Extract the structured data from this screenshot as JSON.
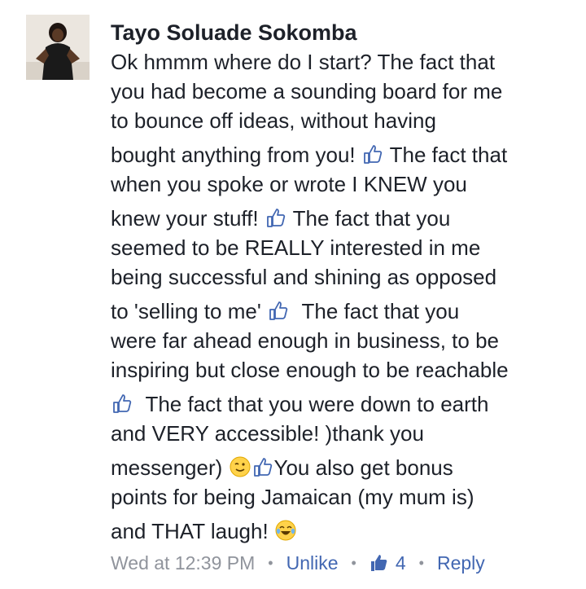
{
  "comment": {
    "author": "Tayo Soluade Sokomba",
    "lines": [
      "Ok hmmm where do I start? The fact that",
      "you had become a sounding board for me",
      "to bounce off ideas, without having",
      "bought anything from you!",
      "The fact that",
      "when you spoke or wrote I KNEW you",
      "knew your stuff!",
      "The fact that you",
      "seemed to be REALLY interested in me",
      "being successful and shining as opposed",
      "to 'selling to me'",
      "The fact that you",
      "were far ahead enough in business, to be",
      "inspiring but close enough to be reachable",
      "The fact that you were down to earth",
      "and VERY accessible! )thank you",
      "messenger)",
      "You also get bonus",
      "points for being Jamaican (my mum is)",
      "and THAT laugh!"
    ],
    "icons": {
      "thumbs_up": "thumbs-up-outline-icon",
      "wink": "winking-face-icon",
      "laugh": "tears-of-joy-icon"
    }
  },
  "footer": {
    "timestamp": "Wed at 12:39 PM",
    "separator": "•",
    "unlike_label": "Unlike",
    "like_count": "4",
    "reply_label": "Reply"
  },
  "colors": {
    "text": "#1d2129",
    "meta": "#90949c",
    "link": "#4267b2"
  }
}
